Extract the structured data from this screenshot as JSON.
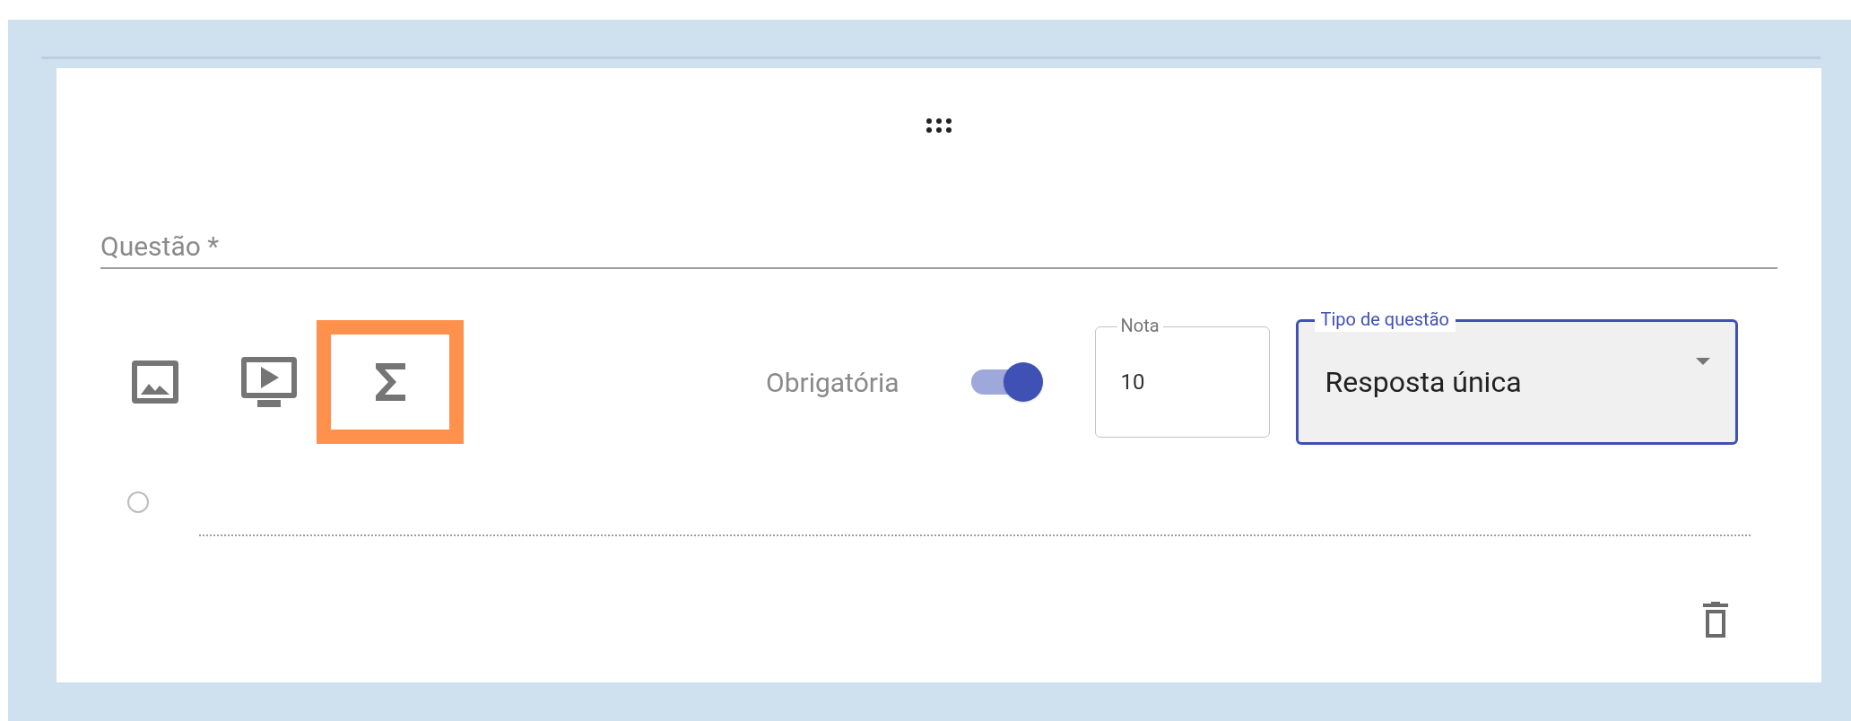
{
  "question_field": {
    "label": "Questão *"
  },
  "media_buttons": [
    {
      "kind": "image",
      "highlighted": false
    },
    {
      "kind": "video",
      "highlighted": false
    },
    {
      "kind": "formula",
      "highlighted": true
    }
  ],
  "required": {
    "label": "Obrigatória",
    "on": true
  },
  "score_field": {
    "label": "Nota",
    "value": "10"
  },
  "type_select": {
    "label": "Tipo de questão",
    "value": "Resposta única"
  },
  "options": [
    {
      "selected": false
    }
  ]
}
